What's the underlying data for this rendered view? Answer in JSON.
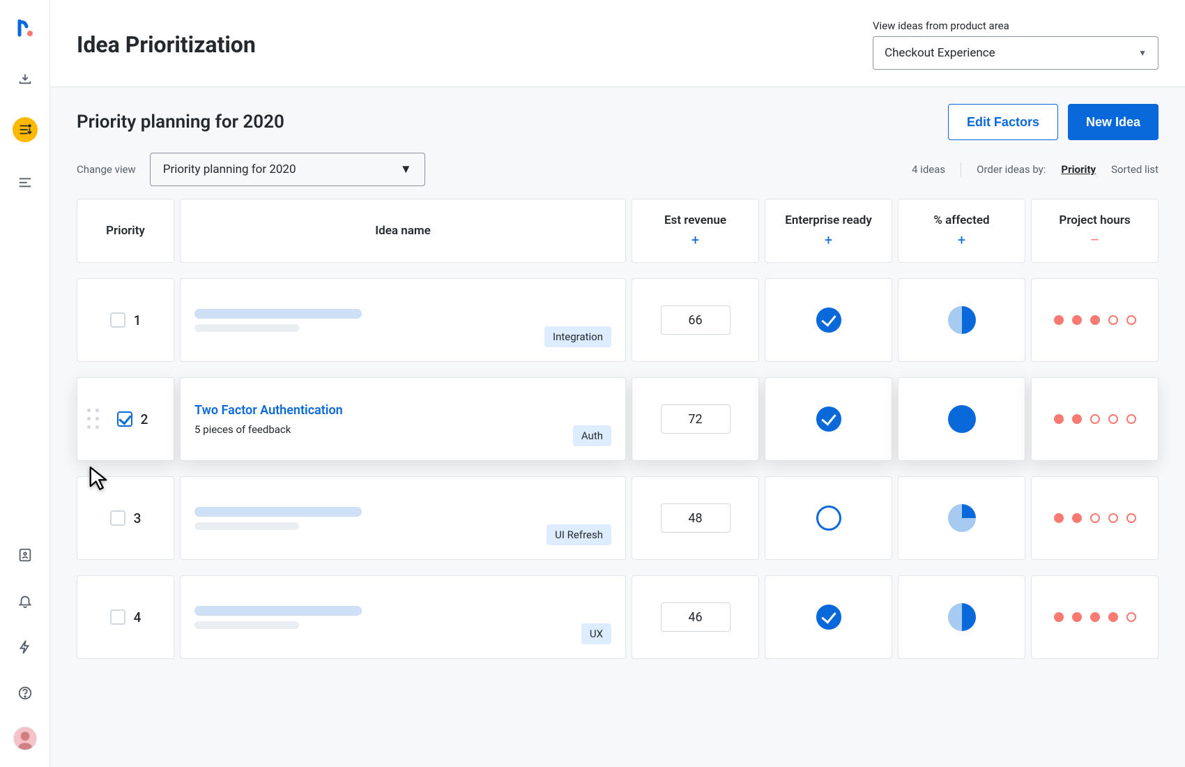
{
  "page": {
    "title": "Idea Prioritization",
    "area_label": "View ideas from product area",
    "area_value": "Checkout Experience"
  },
  "section": {
    "title": "Priority planning for 2020",
    "change_view_label": "Change view",
    "view_value": "Priority planning for 2020",
    "edit_factors": "Edit Factors",
    "new_idea": "New Idea",
    "idea_count": "4 ideas",
    "order_label": "Order ideas by:",
    "order_priority": "Priority",
    "sorted_list": "Sorted list"
  },
  "columns": {
    "priority": "Priority",
    "name": "Idea name",
    "est_revenue": "Est revenue",
    "enterprise_ready": "Enterprise ready",
    "pct_affected": "% affected",
    "project_hours": "Project hours",
    "plus": "+",
    "minus": "–"
  },
  "rows": [
    {
      "rank": "1",
      "checked": false,
      "skeleton": true,
      "tag": "Integration",
      "revenue": "66",
      "ready": true,
      "affected": 50,
      "hours_f": 3,
      "hours_e": 2
    },
    {
      "rank": "2",
      "checked": true,
      "skeleton": false,
      "title": "Two Factor Authentication",
      "subtitle": "5 pieces of feedback",
      "tag": "Auth",
      "revenue": "72",
      "ready": true,
      "affected": 100,
      "hours_f": 2,
      "hours_e": 3
    },
    {
      "rank": "3",
      "checked": false,
      "skeleton": true,
      "tag": "UI Refresh",
      "revenue": "48",
      "ready": false,
      "affected": 25,
      "hours_f": 2,
      "hours_e": 3
    },
    {
      "rank": "4",
      "checked": false,
      "skeleton": true,
      "tag": "UX",
      "revenue": "46",
      "ready": true,
      "affected": 50,
      "hours_f": 4,
      "hours_e": 1
    }
  ]
}
